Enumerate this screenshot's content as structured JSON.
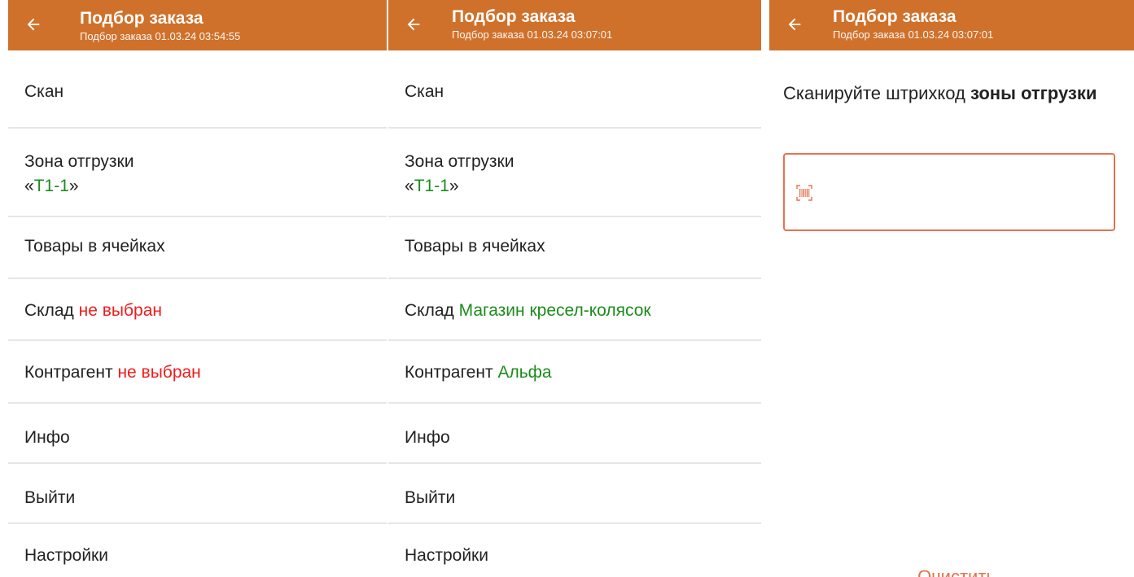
{
  "colors": {
    "accent": "#d0712b",
    "red": "#f01c1c",
    "green": "#1d8c1d",
    "scan_border": "#e9704e"
  },
  "icons": {
    "back": "arrow-left-icon",
    "barcode": "barcode-icon"
  },
  "screens": [
    {
      "title": "Подбор заказа",
      "subtitle": "Подбор заказа 01.03.24 03:54:55",
      "items": [
        {
          "label": "Скан"
        },
        {
          "label": "Зона отгрузки",
          "quote_open": "«",
          "value": "T1-1",
          "quote_close": "»"
        },
        {
          "label": "Товары в ячейках"
        },
        {
          "label": "Склад",
          "value": "не выбран"
        },
        {
          "label": "Контрагент",
          "value": "не выбран"
        },
        {
          "label": "Инфо"
        },
        {
          "label": "Выйти"
        },
        {
          "label": "Настройки"
        }
      ]
    },
    {
      "title": "Подбор заказа",
      "subtitle": "Подбор заказа 01.03.24 03:07:01",
      "items": [
        {
          "label": "Скан"
        },
        {
          "label": "Зона отгрузки",
          "quote_open": "«",
          "value": "T1-1",
          "quote_close": "»"
        },
        {
          "label": "Товары в ячейках"
        },
        {
          "label": "Склад",
          "value": "Магазин кресел-колясок"
        },
        {
          "label": "Контрагент",
          "value": "Альфа"
        },
        {
          "label": "Инфо"
        },
        {
          "label": "Выйти"
        },
        {
          "label": "Настройки"
        }
      ]
    },
    {
      "title": "Подбор заказа",
      "subtitle": "Подбор заказа 01.03.24 03:07:01",
      "prompt_text": "Сканируйте штрихкод ",
      "prompt_bold": "зоны отгрузки",
      "clear_label": "Очистить"
    }
  ]
}
